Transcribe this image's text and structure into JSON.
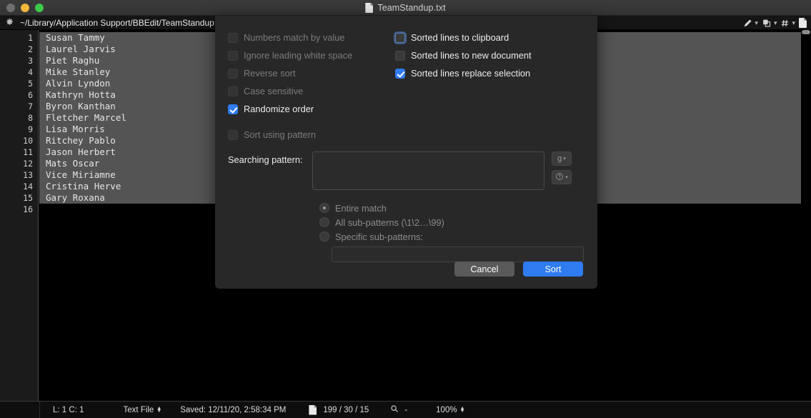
{
  "window": {
    "title": "TeamStandup.txt",
    "title_icon": "document-icon",
    "traffic_lights": [
      "close",
      "minimize",
      "zoom"
    ]
  },
  "pathbar": {
    "gear_icon": "gear-icon",
    "path": "~/Library/Application Support/BBEdit/TeamStandup.t",
    "tools": [
      {
        "icon": "pencil-icon",
        "caret": "⌄"
      },
      {
        "icon": "windows-icon",
        "caret": "⌄"
      },
      {
        "icon": "hash-icon",
        "caret": "⌄"
      },
      {
        "icon": "document-icon",
        "caret": ""
      }
    ]
  },
  "editor": {
    "line_numbers": [
      "1",
      "2",
      "3",
      "4",
      "5",
      "6",
      "7",
      "8",
      "9",
      "10",
      "11",
      "12",
      "13",
      "14",
      "15",
      "16"
    ],
    "lines": [
      "Susan Tammy",
      "Laurel Jarvis",
      "Piet Raghu",
      "Mike Stanley",
      "Alvin Lyndon",
      "Kathryn Hotta",
      "Byron Kanthan",
      "Fletcher Marcel",
      "Lisa Morris",
      "Ritchey Pablo",
      "Jason Herbert",
      "Mats Oscar",
      "Vice Miriamne",
      "Cristina Herve",
      "Gary Roxana",
      ""
    ],
    "selected_line_count": 15
  },
  "statusbar": {
    "cursor": "L: 1 C: 1",
    "filetype": "Text File",
    "saved": "Saved: 12/11/20, 2:58:34 PM",
    "doc_icon": "document-icon",
    "counts": "199 / 30 / 15",
    "search_icon": "magnifier-icon",
    "search_value": "-",
    "zoom": "100%"
  },
  "sort_dialog": {
    "left_options": [
      {
        "label": "Numbers match by value",
        "checked": false,
        "enabled": false,
        "focused": false
      },
      {
        "label": "Ignore leading white space",
        "checked": false,
        "enabled": false,
        "focused": false
      },
      {
        "label": "Reverse sort",
        "checked": false,
        "enabled": false,
        "focused": false
      },
      {
        "label": "Case sensitive",
        "checked": false,
        "enabled": false,
        "focused": false
      },
      {
        "label": "Randomize order",
        "checked": true,
        "enabled": true,
        "focused": false
      }
    ],
    "right_options": [
      {
        "label": "Sorted lines to clipboard",
        "checked": false,
        "enabled": true,
        "focused": true
      },
      {
        "label": "Sorted lines to new document",
        "checked": false,
        "enabled": true,
        "focused": false
      },
      {
        "label": "Sorted lines replace selection",
        "checked": true,
        "enabled": true,
        "focused": false
      }
    ],
    "sort_using_pattern": {
      "label": "Sort using pattern",
      "checked": false,
      "enabled": false
    },
    "searching_pattern": {
      "label": "Searching pattern:",
      "value": "",
      "placeholder": ""
    },
    "pattern_buttons": [
      {
        "icon": "grep-icon",
        "glyph": "g",
        "caret": "▾"
      },
      {
        "icon": "help-icon",
        "glyph": "ⓘ",
        "caret": "▾"
      }
    ],
    "match_options": [
      {
        "label": "Entire match",
        "selected": true,
        "enabled": false
      },
      {
        "label": "All sub-patterns (\\1\\2…\\99)",
        "selected": false,
        "enabled": false
      },
      {
        "label": "Specific sub-patterns:",
        "selected": false,
        "enabled": false
      }
    ],
    "specific_subpatterns": {
      "value": "",
      "placeholder": ""
    },
    "cancel_label": "Cancel",
    "sort_label": "Sort",
    "accent_color": "#2f7bf0"
  }
}
